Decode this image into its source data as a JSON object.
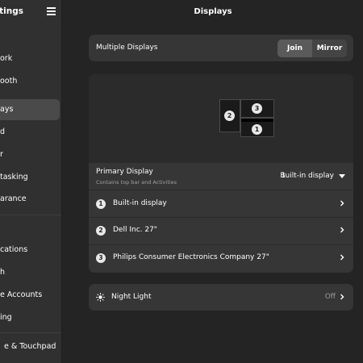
{
  "sidebar": {
    "title": "Settings",
    "items": [
      {
        "label": "ork"
      },
      {
        "label": "ooth"
      },
      {
        "label": "ays"
      },
      {
        "label": "d"
      },
      {
        "label": "r"
      },
      {
        "label": "tasking"
      },
      {
        "label": "arance"
      },
      {
        "label": "cations"
      },
      {
        "label": "h"
      },
      {
        "label": "e Accounts"
      },
      {
        "label": "ing"
      },
      {
        "label": "e & Touchpad"
      }
    ]
  },
  "main": {
    "title": "Displays",
    "multiple_displays": {
      "label": "Multiple Displays",
      "join_label": "Join",
      "mirror_label": "Mirror"
    },
    "arrangement": {
      "monitors": [
        {
          "number": "2"
        },
        {
          "number": "3"
        },
        {
          "number": "1"
        }
      ]
    },
    "primary": {
      "label": "Primary Display",
      "subtitle": "Contains top bar and Activities",
      "number": "1",
      "value": "Built-in display"
    },
    "displays": [
      {
        "number": "1",
        "name": "Built-in display"
      },
      {
        "number": "2",
        "name": "Dell Inc. 27\""
      },
      {
        "number": "3",
        "name": "Philips Consumer Electronics Company 27\""
      }
    ],
    "night_light": {
      "label": "Night Light",
      "status": "Off"
    }
  },
  "colors": {
    "background": "#242424",
    "sidebar": "#303030",
    "card": "#363636",
    "active": "#4a4a4a"
  }
}
